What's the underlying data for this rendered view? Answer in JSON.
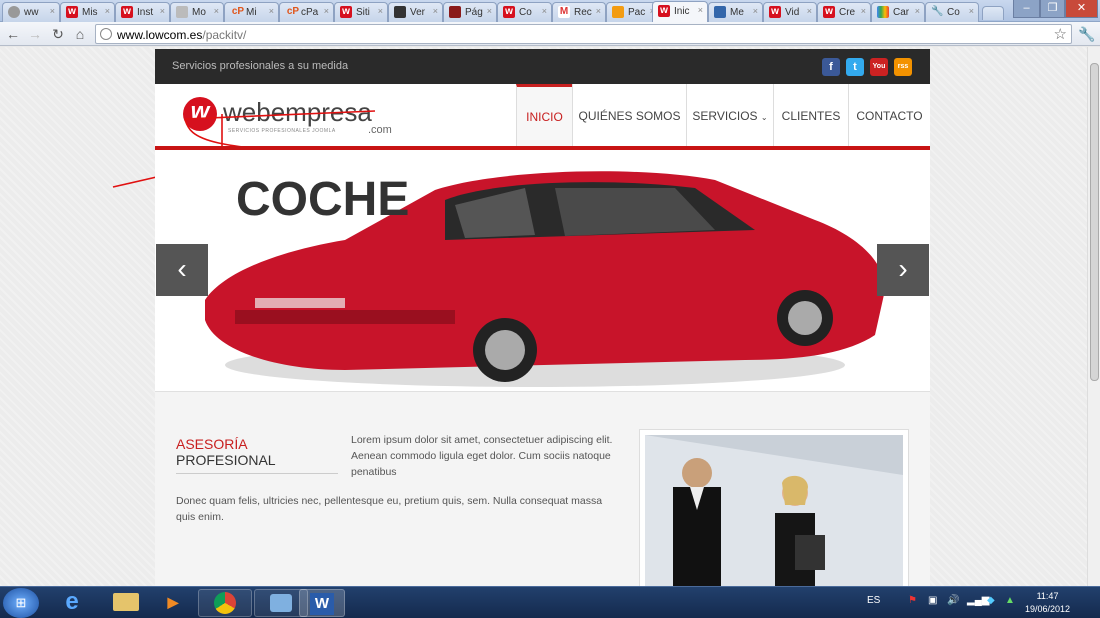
{
  "browser": {
    "tabs": [
      {
        "title": "ww",
        "fav": "globe"
      },
      {
        "title": "Mis",
        "fav": "w"
      },
      {
        "title": "Inst",
        "fav": "w"
      },
      {
        "title": "Mo",
        "fav": "page"
      },
      {
        "title": "Mi",
        "fav": "cP"
      },
      {
        "title": "cPa",
        "fav": "cP"
      },
      {
        "title": "Siti",
        "fav": "w"
      },
      {
        "title": "Ver",
        "fav": "ver"
      },
      {
        "title": "Pág",
        "fav": "pag"
      },
      {
        "title": "Co",
        "fav": "w"
      },
      {
        "title": "Rec",
        "fav": "M"
      },
      {
        "title": "Pac",
        "fav": "joomla"
      },
      {
        "title": "Inic",
        "fav": "w",
        "active": true
      },
      {
        "title": "Me",
        "fav": "me"
      },
      {
        "title": "Vid",
        "fav": "w"
      },
      {
        "title": "Cre",
        "fav": "w"
      },
      {
        "title": "Car",
        "fav": "google"
      },
      {
        "title": "Co",
        "fav": "wrench"
      }
    ],
    "url_host": "www.lowcom.es",
    "url_path": "/packitv/"
  },
  "site": {
    "tagline": "Servicios profesionales a su medida",
    "social": [
      "f",
      "t",
      "You",
      "rss"
    ],
    "logo": {
      "mark": "w",
      "name": "webempresa",
      "sub": "SERVICIOS PROFESIONALES JOOMLA",
      "com": ".com"
    },
    "nav": [
      "INICIO",
      "QUIÉNES SOMOS",
      "SERVICIOS",
      "CLIENTES",
      "CONTACTO"
    ],
    "slider_caption": "COCHE",
    "section_heading_red": "ASESORÍA",
    "section_heading_rest": " PROFESIONAL",
    "para1": "Lorem ipsum dolor sit amet, consectetuer adipiscing elit. Aenean commodo ligula eget dolor. Cum sociis natoque penatibus",
    "para2": "Donec quam felis, ultricies nec, pellentesque eu, pretium quis, sem. Nulla consequat massa quis enim."
  },
  "taskbar": {
    "lang": "ES",
    "time": "11:47",
    "date": "19/06/2012"
  },
  "colors": {
    "accent": "#c82020",
    "topbar": "#2a2a2a"
  }
}
